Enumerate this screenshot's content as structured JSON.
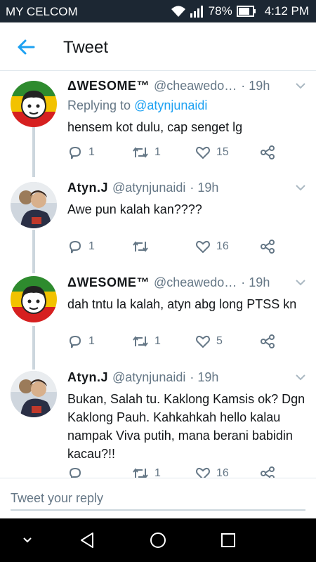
{
  "status_bar": {
    "carrier": "MY CELCOM",
    "battery": "78%",
    "time": "4:12 PM"
  },
  "header": {
    "title": "Tweet"
  },
  "tweets": [
    {
      "name": "ΔWESOME™",
      "handle": "@cheawedo…",
      "time": "· 19h",
      "replying_prefix": "Replying to ",
      "replying_to": "@atynjunaidi",
      "text": "hensem kot dulu, cap senget lg",
      "replies": "1",
      "retweets": "1",
      "likes": "15"
    },
    {
      "name": "Atyn.J",
      "handle": "@atynjunaidi",
      "time": "· 19h",
      "text": "Awe pun kalah kan????",
      "replies": "1",
      "retweets": "",
      "likes": "16"
    },
    {
      "name": "ΔWESOME™",
      "handle": "@cheawedo…",
      "time": "· 19h",
      "text": "dah tntu la kalah, atyn abg long PTSS kn",
      "replies": "1",
      "retweets": "1",
      "likes": "5"
    },
    {
      "name": "Atyn.J",
      "handle": "@atynjunaidi",
      "time": "· 19h",
      "text": "Bukan, Salah tu. Kaklong Kamsis ok? Dgn Kaklong Pauh. Kahkahkah hello kalau nampak Viva putih, mana berani babidin kacau?!!",
      "replies": "",
      "retweets": "1",
      "likes": "16"
    }
  ],
  "reply_box": {
    "placeholder": "Tweet your reply"
  },
  "colors": {
    "accent": "#1da1f2",
    "status_bar": "#1c2733",
    "muted": "#657786"
  },
  "icons": [
    "wifi-icon",
    "signal-icon",
    "battery-icon",
    "back-arrow-icon",
    "chevron-down-icon",
    "reply-icon",
    "retweet-icon",
    "like-icon",
    "share-icon",
    "nav-back-icon",
    "nav-home-icon",
    "nav-recents-icon",
    "nav-down-icon"
  ]
}
